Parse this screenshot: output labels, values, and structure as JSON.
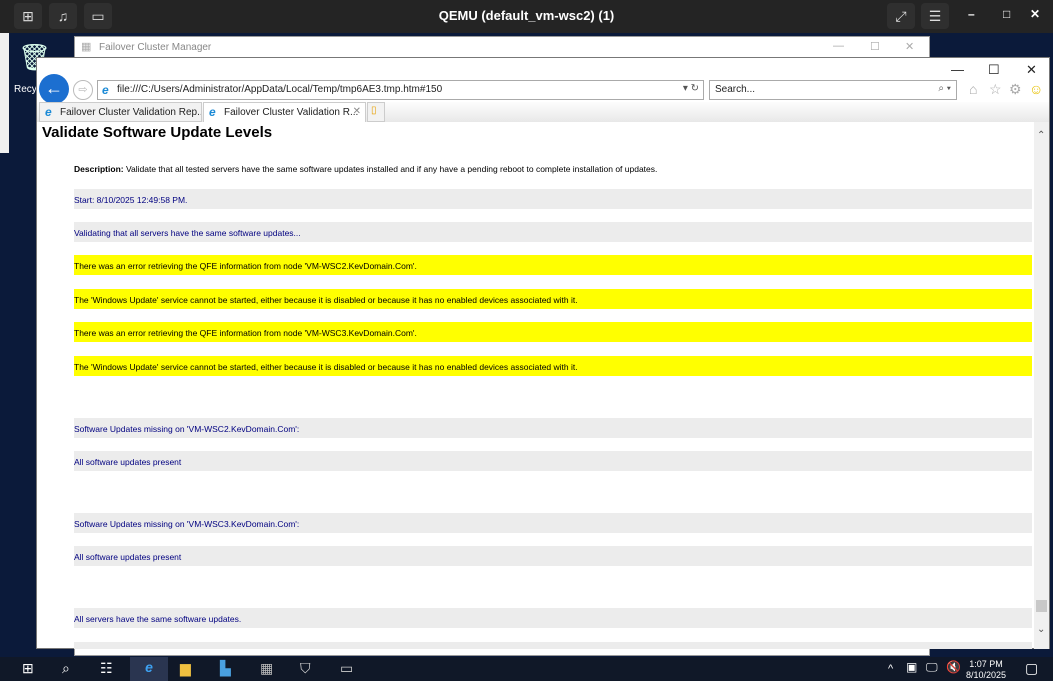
{
  "qemu": {
    "title": "QEMU (default_vm-wsc2) (1)"
  },
  "desktop": {
    "recycle_label": "Recy"
  },
  "fcm": {
    "title": "Failover Cluster Manager"
  },
  "ie": {
    "address": "file:///C:/Users/Administrator/AppData/Local/Temp/tmp6AE3.tmp.htm#150",
    "search_placeholder": "Search...",
    "tabs": [
      {
        "label": "Failover Cluster Validation Rep..."
      },
      {
        "label": "Failover Cluster Validation R..."
      }
    ]
  },
  "page": {
    "heading": "Validate Software Update Levels",
    "description_label": "Description:",
    "description": " Validate that all tested servers have the same software updates installed and if any have a pending reboot to complete installation of updates.",
    "rows": [
      "Start: 8/10/2025 12:49:58 PM.",
      "Validating that all servers have the same software updates...",
      "There was an error retrieving the QFE information from node 'VM-WSC2.KevDomain.Com'.",
      "The 'Windows Update' service cannot be started, either because it is disabled or because it has no enabled devices associated with it.",
      "There was an error retrieving the QFE information from node 'VM-WSC3.KevDomain.Com'.",
      "The 'Windows Update' service cannot be started, either because it is disabled or because it has no enabled devices associated with it.",
      "Software Updates missing on 'VM-WSC2.KevDomain.Com':",
      "All software updates present",
      "Software Updates missing on 'VM-WSC3.KevDomain.Com':",
      "All software updates present",
      "All servers have the same software updates."
    ]
  },
  "taskbar": {
    "time": "1:07 PM",
    "date": "8/10/2025"
  }
}
